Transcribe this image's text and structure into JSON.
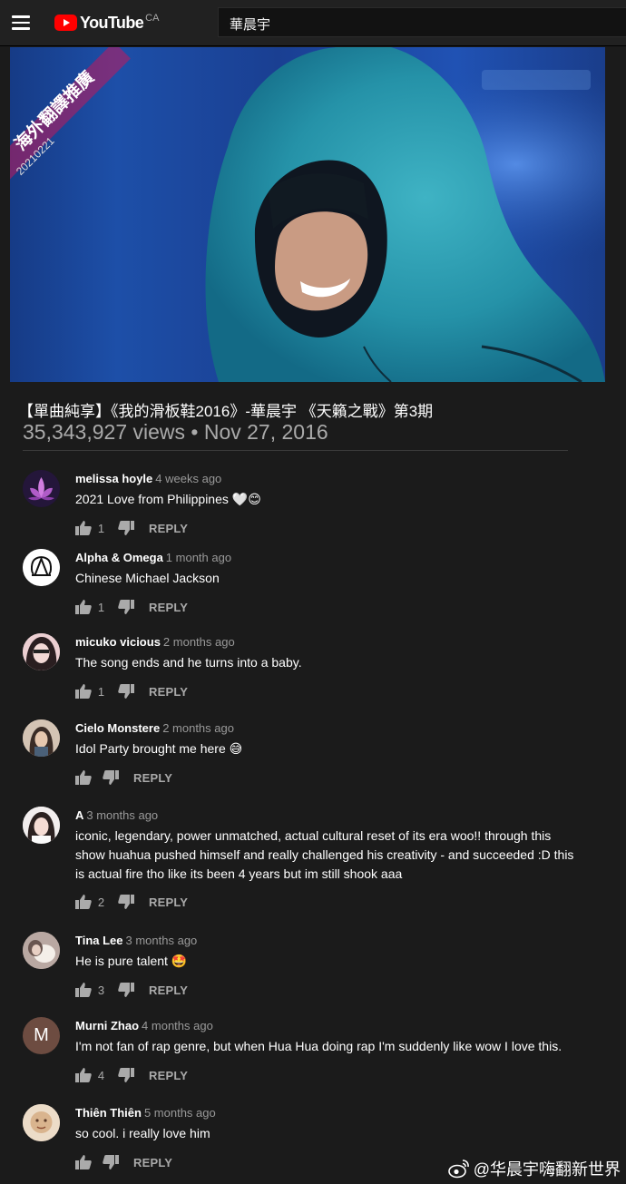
{
  "header": {
    "logo_text": "YouTube",
    "country": "CA",
    "search_value": "華晨宇"
  },
  "video": {
    "overlay_text": "海外翻譯推廣",
    "overlay_date": "20210221",
    "title": "【單曲純享】《我的滑板鞋2016》-華晨宇 《天籟之戰》第3期",
    "meta": "35,343,927 views • Nov 27, 2016"
  },
  "comments": [
    {
      "author": "melissa hoyle",
      "time": "4 weeks ago",
      "text": "2021 Love from Philippines 🤍😊",
      "likes": "1",
      "reply": "REPLY"
    },
    {
      "author": "Alpha & Omega",
      "time": "1 month ago",
      "text": "Chinese Michael Jackson",
      "likes": "1",
      "reply": "REPLY"
    },
    {
      "author": "micuko vicious",
      "time": "2 months ago",
      "text": "The song ends and he turns into a baby.",
      "likes": "1",
      "reply": "REPLY"
    },
    {
      "author": "Cielo Monstere",
      "time": "2 months ago",
      "text": "Idol Party brought me here 😅",
      "likes": "",
      "reply": "REPLY"
    },
    {
      "author": "A",
      "time": "3 months ago",
      "text": "iconic, legendary, power unmatched, actual cultural reset of its era woo!! through this show huahua pushed himself and really challenged his creativity - and succeeded :D this is actual fire tho like its been 4 years but im still shook aaa",
      "likes": "2",
      "reply": "REPLY"
    },
    {
      "author": "Tina Lee",
      "time": "3 months ago",
      "text": "He is pure talent 🤩",
      "likes": "3",
      "reply": "REPLY"
    },
    {
      "author": "Murni Zhao",
      "time": "4 months ago",
      "text": "I'm not fan of rap genre, but when Hua Hua doing rap I'm suddenly like wow I love this.",
      "likes": "4",
      "reply": "REPLY",
      "avatar_letter": "M"
    },
    {
      "author": "Thiên Thiên",
      "time": "5 months ago",
      "text": "so cool. i really love him",
      "likes": "",
      "reply": "REPLY"
    }
  ],
  "watermark": "@华晨宇嗨翻新世界"
}
